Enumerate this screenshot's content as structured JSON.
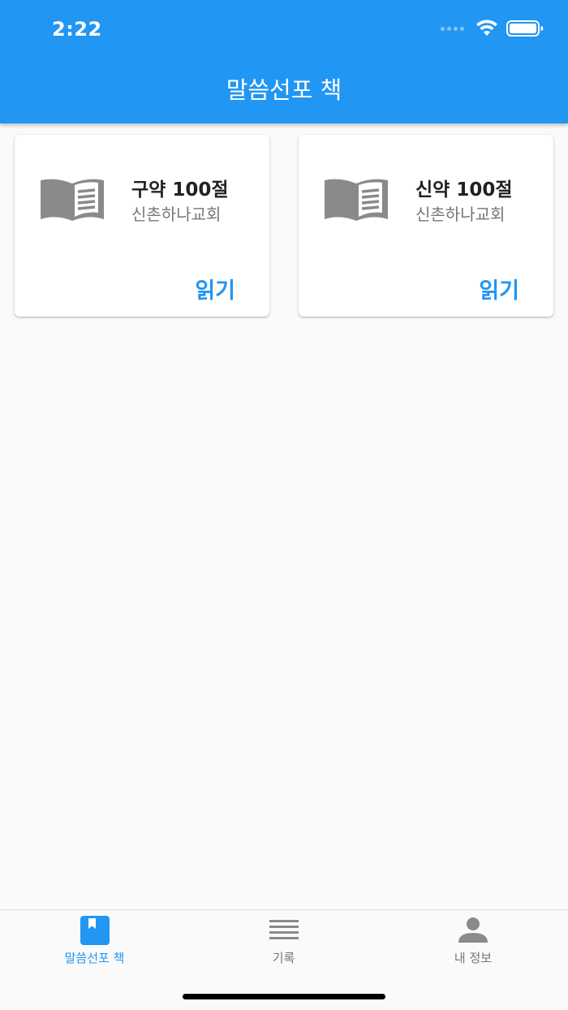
{
  "status_bar": {
    "time": "2:22"
  },
  "appbar": {
    "title": "말씀선포 책"
  },
  "cards": [
    {
      "title": "구약 100절",
      "subtitle": "신촌하나교회",
      "action": "읽기"
    },
    {
      "title": "신약 100절",
      "subtitle": "신촌하나교회",
      "action": "읽기"
    }
  ],
  "bottom_nav": {
    "items": [
      {
        "label": "말씀선포 책",
        "icon": "book-icon",
        "active": true
      },
      {
        "label": "기록",
        "icon": "list-icon",
        "active": false
      },
      {
        "label": "내 정보",
        "icon": "person-icon",
        "active": false
      }
    ]
  },
  "colors": {
    "primary": "#2196f3",
    "icon_gray": "#8a8a8a",
    "background": "#fafafa"
  }
}
